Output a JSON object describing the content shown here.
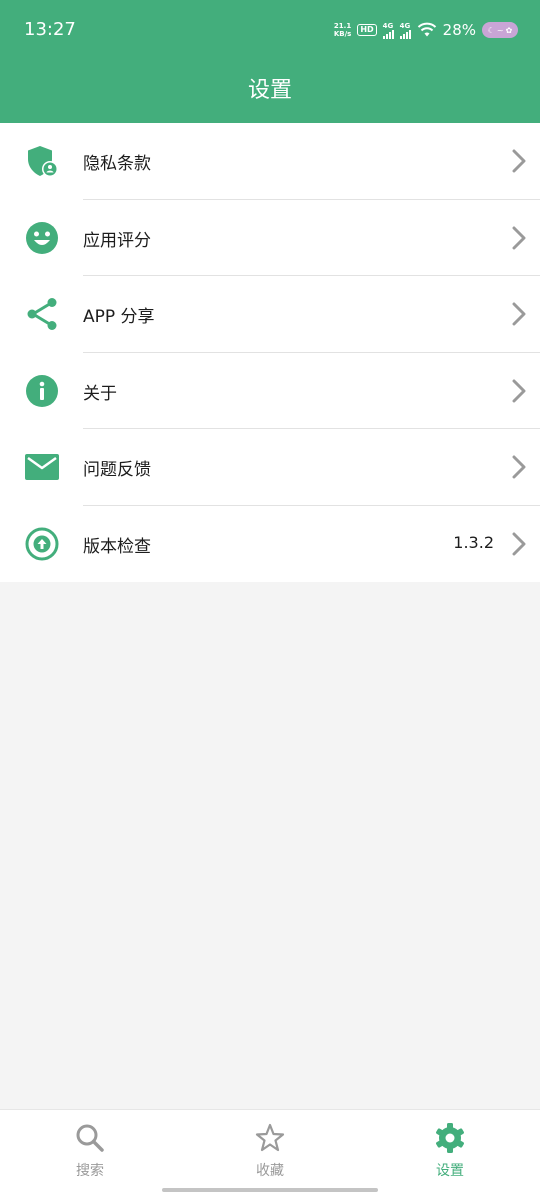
{
  "status_bar": {
    "time": "13:27",
    "net_speed_value": "21.1",
    "net_speed_unit": "KB/s",
    "hd_label": "HD",
    "sim1_label": "4G",
    "sim2_label": "4G",
    "battery": "28%"
  },
  "header": {
    "title": "设置"
  },
  "settings": {
    "items": [
      {
        "label": "隐私条款",
        "icon": "shield-user-icon"
      },
      {
        "label": "应用评分",
        "icon": "smiley-icon"
      },
      {
        "label": "APP 分享",
        "icon": "share-icon"
      },
      {
        "label": "关于",
        "icon": "info-icon"
      },
      {
        "label": "问题反馈",
        "icon": "mail-icon"
      },
      {
        "label": "版本检查",
        "icon": "upload-arrow-icon",
        "value": "1.3.2"
      }
    ]
  },
  "bottom_nav": {
    "tabs": [
      {
        "label": "搜索",
        "icon": "search-icon",
        "active": false
      },
      {
        "label": "收藏",
        "icon": "star-icon",
        "active": false
      },
      {
        "label": "设置",
        "icon": "gear-icon",
        "active": true
      }
    ]
  },
  "colors": {
    "primary": "#43ae7c",
    "inactive": "#9a9a9a",
    "background": "#f4f4f4"
  }
}
